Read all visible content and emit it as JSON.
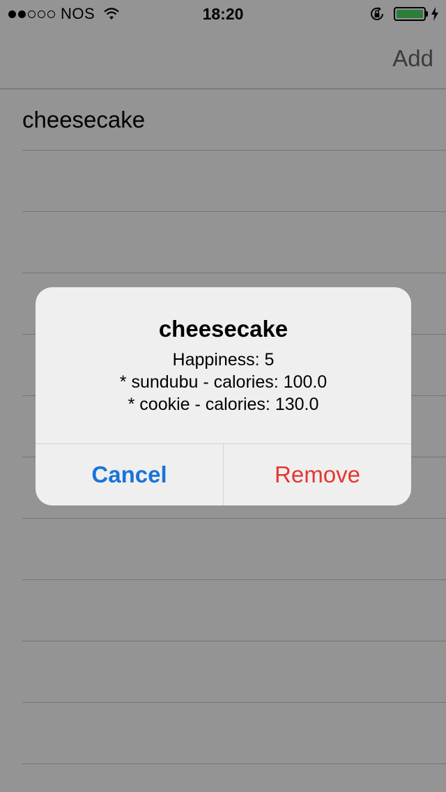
{
  "status_bar": {
    "carrier": "NOS",
    "time": "18:20",
    "signal_icon": "signal-dots-icon",
    "wifi_icon": "wifi-icon",
    "lock_icon": "rotation-lock-icon",
    "battery_icon": "battery-icon",
    "battery_level": 1.0,
    "charging_icon": "bolt-icon",
    "battery_color": "#4cd964"
  },
  "nav_bar": {
    "add_label": "Add"
  },
  "table": {
    "rows": [
      {
        "label": "cheesecake"
      },
      {
        "label": ""
      },
      {
        "label": ""
      },
      {
        "label": ""
      },
      {
        "label": ""
      },
      {
        "label": ""
      },
      {
        "label": ""
      },
      {
        "label": ""
      },
      {
        "label": ""
      },
      {
        "label": ""
      },
      {
        "label": ""
      },
      {
        "label": ""
      }
    ]
  },
  "alert": {
    "title": "cheesecake",
    "message_lines": [
      "Happiness: 5",
      "* sundubu - calories: 100.0",
      "* cookie - calories: 130.0"
    ],
    "cancel_label": "Cancel",
    "remove_label": "Remove",
    "cancel_color": "#1a74d9",
    "remove_color": "#e2382f"
  }
}
